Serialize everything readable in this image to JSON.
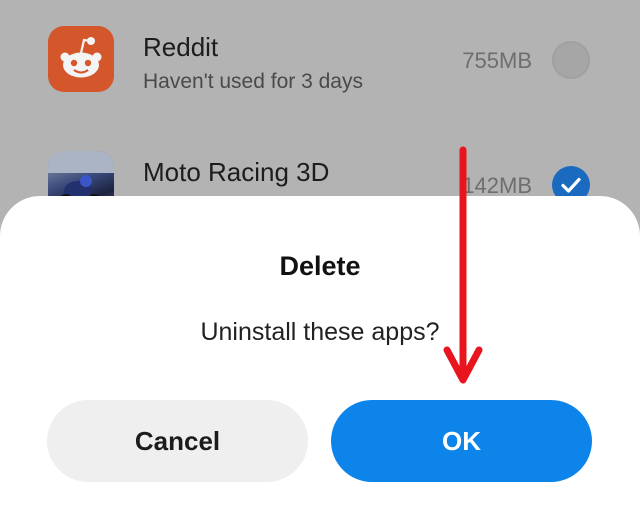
{
  "apps": [
    {
      "name": "Reddit",
      "subtitle": "Haven't used for 3 days",
      "size": "755MB",
      "selected": false,
      "icon": "reddit-alien-icon",
      "icon_color": "#d4572b"
    },
    {
      "name": "Moto Racing 3D",
      "subtitle": "",
      "size": "142MB",
      "selected": true,
      "icon": "moto-racing-icon"
    }
  ],
  "dialog": {
    "title": "Delete",
    "message": "Uninstall these apps?",
    "cancel_label": "Cancel",
    "ok_label": "OK"
  },
  "colors": {
    "overlay": "#b3b3b3",
    "ok_button": "#0d84ea",
    "cancel_button": "#efefef",
    "checked": "#1a6bbf",
    "annotation_arrow": "#e8141e"
  }
}
